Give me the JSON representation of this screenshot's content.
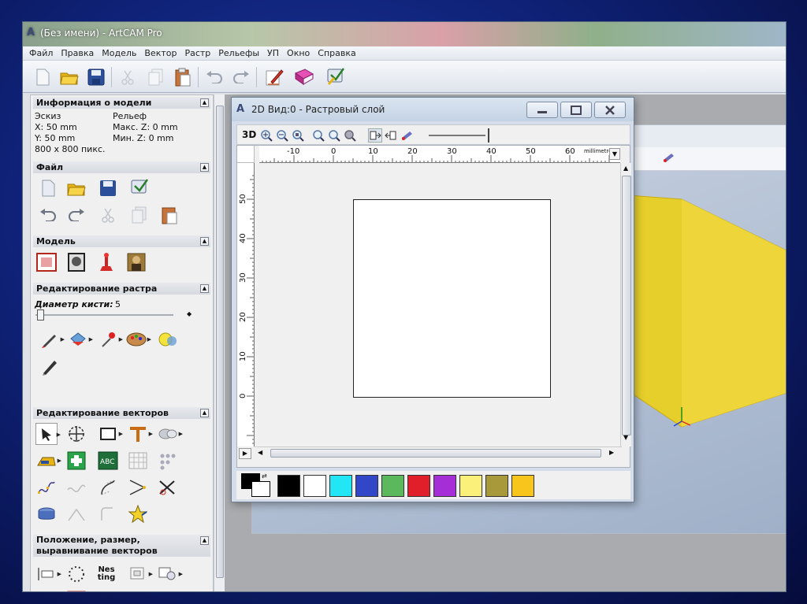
{
  "window": {
    "title": "(Без имени) - ArtCAM Pro"
  },
  "menu": [
    "Файл",
    "Правка",
    "Модель",
    "Вектор",
    "Растр",
    "Рельефы",
    "УП",
    "Окно",
    "Справка"
  ],
  "toolbar": [
    "new-file-icon",
    "open-folder-icon",
    "save-icon",
    "cut-icon",
    "copy-icon",
    "paste-icon",
    "undo-icon",
    "redo-icon",
    "edit-icon",
    "book-icon",
    "wizard-icon"
  ],
  "model_info": {
    "header": "Информация о модели",
    "sketch_label": "Эскиз",
    "relief_label": "Рельеф",
    "x": "X: 50 mm",
    "y": "Y: 50 mm",
    "pixels": "800 x 800 пикс.",
    "max_z": "Макс. Z: 0 mm",
    "min_z": "Мин. Z: 0 mm"
  },
  "sections": {
    "file": "Файл",
    "model": "Модель",
    "raster_edit": "Редактирование растра",
    "vector_edit": "Редактирование векторов",
    "position": "Положение, размер, выравнивание векторов"
  },
  "brush": {
    "label": "Диаметр кисти:",
    "value": "5"
  },
  "nesting_icon_text": "Nes ting",
  "view2d": {
    "title": "2D Вид:0 - Растровый слой",
    "mode_3d": "3D",
    "units": "millimetres",
    "h_ticks": [
      "-10",
      "0",
      "10",
      "20",
      "30",
      "40",
      "50",
      "60"
    ],
    "v_ticks": [
      "50",
      "40",
      "30",
      "20",
      "10",
      "0"
    ]
  },
  "colors": {
    "primary": "#000000",
    "secondary": "#ffffff",
    "palette": [
      "#000000",
      "#ffffff",
      "#22e5f5",
      "#3246c8",
      "#5cb85c",
      "#e01f2a",
      "#a52ed6",
      "#fbf07a",
      "#a89a3a",
      "#f7c51b"
    ]
  }
}
